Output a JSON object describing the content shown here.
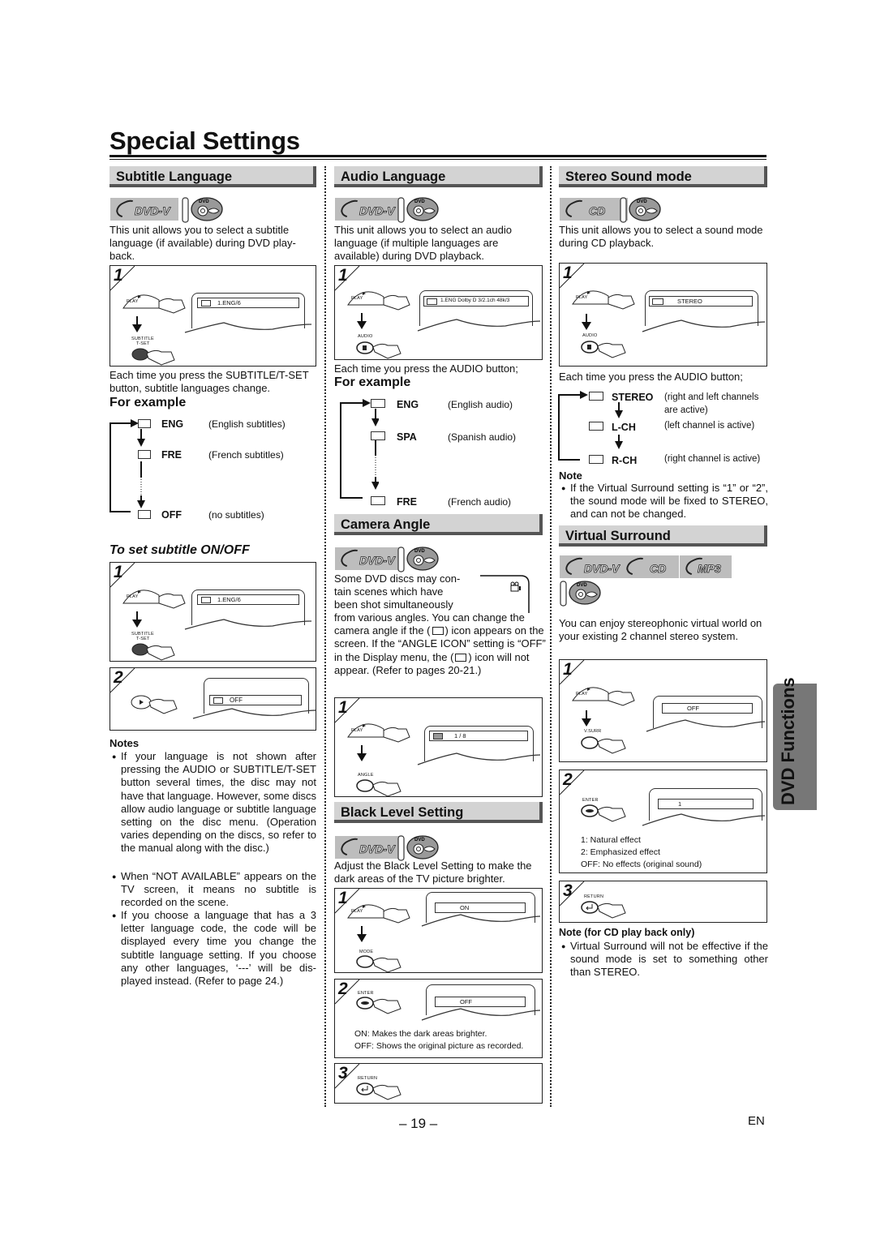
{
  "page": {
    "title": "Special Settings",
    "page_number": "– 19 –",
    "language": "EN",
    "side_tab": "DVD Functions"
  },
  "icons": {
    "disc_badge": "disc-format-badge",
    "remote": "remote-control-icon",
    "subtitle_osd": "subtitle-icon",
    "audio_osd": "audio-icon",
    "angle_osd": "camera-angle-icon"
  },
  "subtitle_language": {
    "heading": "Subtitle Language",
    "badges": [
      "DVD-V"
    ],
    "disc_label": "DVD",
    "intro": "This unit allows you to select a subtitle language (if available) during DVD play-back.",
    "step1": {
      "num": "1",
      "btn1": "PLAY",
      "btn2_line1": "SUBTITLE",
      "btn2_line2": "T-SET",
      "osd": "1.ENG/6"
    },
    "each_time": "Each time you press the SUBTITLE/T-SET button, subtitle languages change.",
    "example_heading": "For example",
    "examples": [
      {
        "code": "ENG",
        "desc": "(English subtitles)"
      },
      {
        "code": "FRE",
        "desc": "(French subtitles)"
      },
      {
        "code": "OFF",
        "desc": "(no subtitles)"
      }
    ],
    "onoff_heading": "To set subtitle ON/OFF",
    "onoff_step1": {
      "num": "1",
      "btn1": "PLAY",
      "btn2_line1": "SUBTITLE",
      "btn2_line2": "T-SET",
      "osd": "1.ENG/6"
    },
    "onoff_step2": {
      "num": "2",
      "osd": "OFF"
    },
    "notes_heading": "Notes",
    "notes": [
      "If your language is not shown after pressing the AUDIO or SUBTITLE/T-SET button several times, the disc may not have that language. However, some discs allow audio language or subtitle language setting on the disc menu. (Operation varies depending on the discs, so refer to the manual along with the disc.)",
      "When “NOT AVAILABLE” appears on the TV screen, it means no subtitle is recorded on the scene.",
      "If you choose a language that has a 3 letter language code, the code will be displayed every time you change the subtitle language setting. If you choose any other languages, ‘---’ will be dis-played instead. (Refer to page 24.)"
    ]
  },
  "audio_language": {
    "heading": "Audio Language",
    "badges": [
      "DVD-V"
    ],
    "disc_label": "DVD",
    "intro": "This unit allows you to select an audio language (if multiple languages are available) during DVD playback.",
    "step1": {
      "num": "1",
      "btn1": "PLAY",
      "btn2": "AUDIO",
      "osd": "1.ENG  Dolby D  3/2.1ch  48k/3"
    },
    "each_time": "Each time you press the AUDIO button;",
    "example_heading": "For example",
    "examples": [
      {
        "code": "ENG",
        "desc": "(English audio)"
      },
      {
        "code": "SPA",
        "desc": "(Spanish audio)"
      },
      {
        "code": "FRE",
        "desc": "(French audio)"
      }
    ]
  },
  "camera_angle": {
    "heading": "Camera Angle",
    "badges": [
      "DVD-V"
    ],
    "disc_label": "DVD",
    "intro_lines": [
      "Some DVD discs may con-",
      "tain scenes which have",
      "been shot simultaneously"
    ],
    "body_1": "from various angles. You can change the camera angle if the (",
    "body_2": ") icon appears on the screen. If the “ANGLE ICON” setting is “OFF” in the Display menu, the (",
    "body_3": ") icon will not appear. (Refer to pages 20-21.)",
    "step1": {
      "num": "1",
      "btn1": "PLAY",
      "btn2": "ANGLE",
      "osd": "1 / 8"
    }
  },
  "black_level": {
    "heading": "Black Level Setting",
    "badges": [
      "DVD-V"
    ],
    "disc_label": "DVD",
    "intro": "Adjust the Black Level Setting to make the dark areas of the TV picture brighter.",
    "step1": {
      "num": "1",
      "btn1": "PLAY",
      "btn2": "MODE",
      "osd": "ON"
    },
    "step2": {
      "num": "2",
      "btn": "ENTER",
      "osd": "OFF",
      "legend": [
        "ON: Makes the dark areas brighter.",
        "OFF: Shows the original picture as recorded."
      ]
    },
    "step3": {
      "num": "3",
      "btn": "RETURN"
    }
  },
  "stereo_sound": {
    "heading": "Stereo Sound mode",
    "badges": [
      "CD"
    ],
    "disc_label": "DVD",
    "intro": "This unit allows you to select a sound mode during CD playback.",
    "step1": {
      "num": "1",
      "btn1": "PLAY",
      "btn2": "AUDIO",
      "osd": "STEREO"
    },
    "each_time": "Each time you press the AUDIO button;",
    "examples": [
      {
        "code": "STEREO",
        "desc_1": "(right and left channels",
        "desc_2": "are active)"
      },
      {
        "code": "L-CH",
        "desc_1": "(left channel is active)"
      },
      {
        "code": "R-CH",
        "desc_1": "(right channel is active)"
      }
    ],
    "note_heading": "Note",
    "note": "If the Virtual Surround setting is “1” or “2”, the sound mode will be fixed to STEREO, and can not be changed."
  },
  "virtual_surround": {
    "heading": "Virtual Surround",
    "badges": [
      "DVD-V",
      "CD",
      "MP3"
    ],
    "disc_label": "DVD",
    "intro": "You can enjoy stereophonic virtual world on your existing 2 channel stereo system.",
    "step1": {
      "num": "1",
      "btn1": "PLAY",
      "btn2": "V.SURR",
      "osd": "OFF"
    },
    "step2": {
      "num": "2",
      "btn": "ENTER",
      "osd": "1",
      "legend": [
        "1: Natural effect",
        "2: Emphasized effect",
        "OFF: No effects (original sound)"
      ]
    },
    "step3": {
      "num": "3",
      "btn": "RETURN"
    },
    "note_heading": "Note (for CD play back only)",
    "note": "Virtual Surround will not be effective if the sound mode is set to something other than STEREO."
  }
}
